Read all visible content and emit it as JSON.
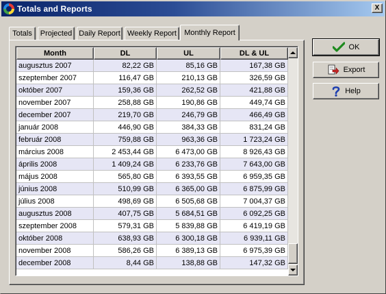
{
  "window": {
    "title": "Totals and Reports",
    "close_glyph": "X"
  },
  "tabs": [
    {
      "label": "Totals"
    },
    {
      "label": "Projected"
    },
    {
      "label": "Daily Report"
    },
    {
      "label": "Weekly Report"
    },
    {
      "label": "Monthly Report",
      "active": true
    }
  ],
  "table": {
    "columns": [
      "Month",
      "DL",
      "UL",
      "DL & UL"
    ],
    "rows": [
      [
        "augusztus 2007",
        "82,22 GB",
        "85,16 GB",
        "167,38 GB"
      ],
      [
        "szeptember 2007",
        "116,47 GB",
        "210,13 GB",
        "326,59 GB"
      ],
      [
        "október 2007",
        "159,36 GB",
        "262,52 GB",
        "421,88 GB"
      ],
      [
        "november 2007",
        "258,88 GB",
        "190,86 GB",
        "449,74 GB"
      ],
      [
        "december 2007",
        "219,70 GB",
        "246,79 GB",
        "466,49 GB"
      ],
      [
        "január 2008",
        "446,90 GB",
        "384,33 GB",
        "831,24 GB"
      ],
      [
        "február 2008",
        "759,88 GB",
        "963,36 GB",
        "1 723,24 GB"
      ],
      [
        "március 2008",
        "2 453,44 GB",
        "6 473,00 GB",
        "8 926,43 GB"
      ],
      [
        "április 2008",
        "1 409,24 GB",
        "6 233,76 GB",
        "7 643,00 GB"
      ],
      [
        "május 2008",
        "565,80 GB",
        "6 393,55 GB",
        "6 959,35 GB"
      ],
      [
        "június 2008",
        "510,99 GB",
        "6 365,00 GB",
        "6 875,99 GB"
      ],
      [
        "július 2008",
        "498,69 GB",
        "6 505,68 GB",
        "7 004,37 GB"
      ],
      [
        "augusztus 2008",
        "407,75 GB",
        "5 684,51 GB",
        "6 092,25 GB"
      ],
      [
        "szeptember 2008",
        "579,31 GB",
        "5 839,88 GB",
        "6 419,19 GB"
      ],
      [
        "október 2008",
        "638,93 GB",
        "6 300,18 GB",
        "6 939,11 GB"
      ],
      [
        "november 2008",
        "586,26 GB",
        "6 389,13 GB",
        "6 975,39 GB"
      ],
      [
        "december 2008",
        "8,44 GB",
        "138,88 GB",
        "147,32 GB"
      ]
    ]
  },
  "buttons": {
    "ok": {
      "label": "OK",
      "icon": "checkmark-icon"
    },
    "export": {
      "label": "Export",
      "icon": "export-icon"
    },
    "help": {
      "label": "Help",
      "icon": "question-icon"
    }
  },
  "colors": {
    "titlebar": "#0a246a",
    "row_alt": "#e6e6f5",
    "face": "#d4d0c8"
  }
}
